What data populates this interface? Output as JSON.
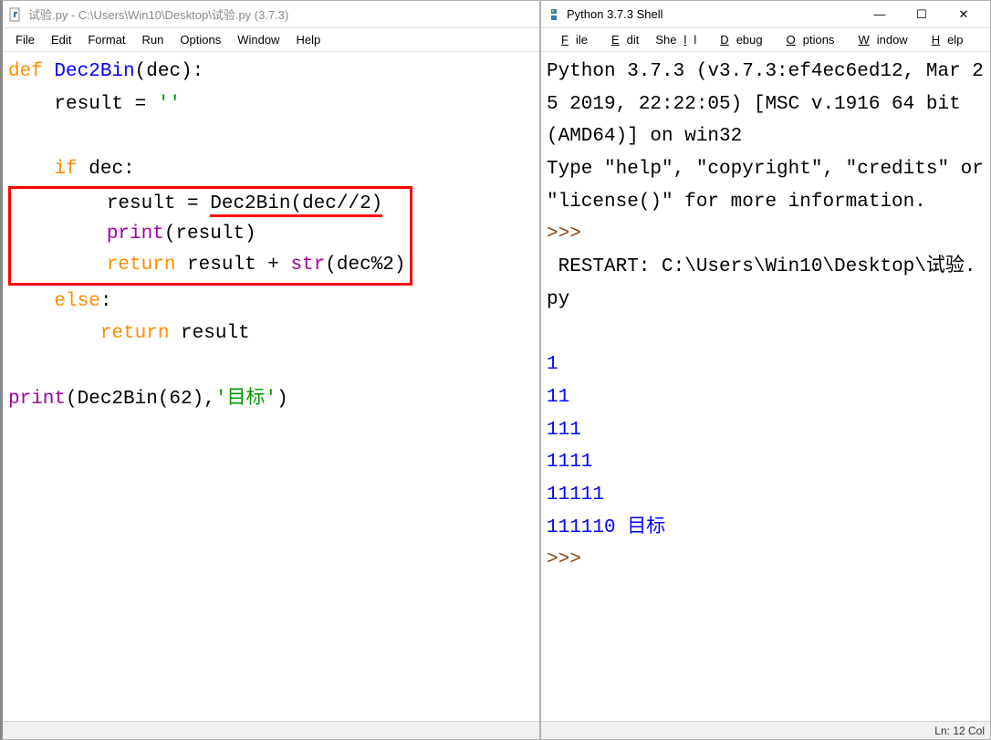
{
  "editor": {
    "title": "试验.py - C:\\Users\\Win10\\Desktop\\试验.py (3.7.3)",
    "menu": [
      "File",
      "Edit",
      "Format",
      "Run",
      "Options",
      "Window",
      "Help"
    ],
    "code": {
      "l1_def": "def",
      "l1_fn": "Dec2Bin",
      "l1_rest": "(dec):",
      "l2": "    result = ",
      "l2_str": "''",
      "l4_if": "if",
      "l4_rest": " dec:",
      "l5a": "        result = ",
      "l5b": "Dec2Bin(dec//2)",
      "l6_print": "print",
      "l6_rest": "(result)",
      "l7_return": "return",
      "l7_rest": " result + ",
      "l7_str": "str",
      "l7_tail": "(dec%2)",
      "l8_else": "else",
      "l8_rest": ":",
      "l9_return": "return",
      "l9_rest": " result",
      "l11_print": "print",
      "l11_a": "(Dec2Bin(62),",
      "l11_str": "'目标'",
      "l11_b": ")"
    }
  },
  "shell": {
    "title": "Python 3.7.3 Shell",
    "menu": [
      "File",
      "Edit",
      "Shell",
      "Debug",
      "Options",
      "Window",
      "Help"
    ],
    "banner": "Python 3.7.3 (v3.7.3:ef4ec6ed12, Mar 25 2019, 22:22:05) [MSC v.1916 64 bit (AMD64)] on win32",
    "help": "Type \"help\", \"copyright\", \"credits\" or \"license()\" for more information.",
    "prompt": ">>> ",
    "restart": " RESTART: C:\\Users\\Win10\\Desktop\\试验.py ",
    "outputs": [
      "",
      "1",
      "11",
      "111",
      "1111",
      "11111",
      "111110 目标"
    ],
    "status": "Ln: 12  Col"
  },
  "win_controls": {
    "min": "—",
    "max": "☐",
    "close": "✕"
  }
}
